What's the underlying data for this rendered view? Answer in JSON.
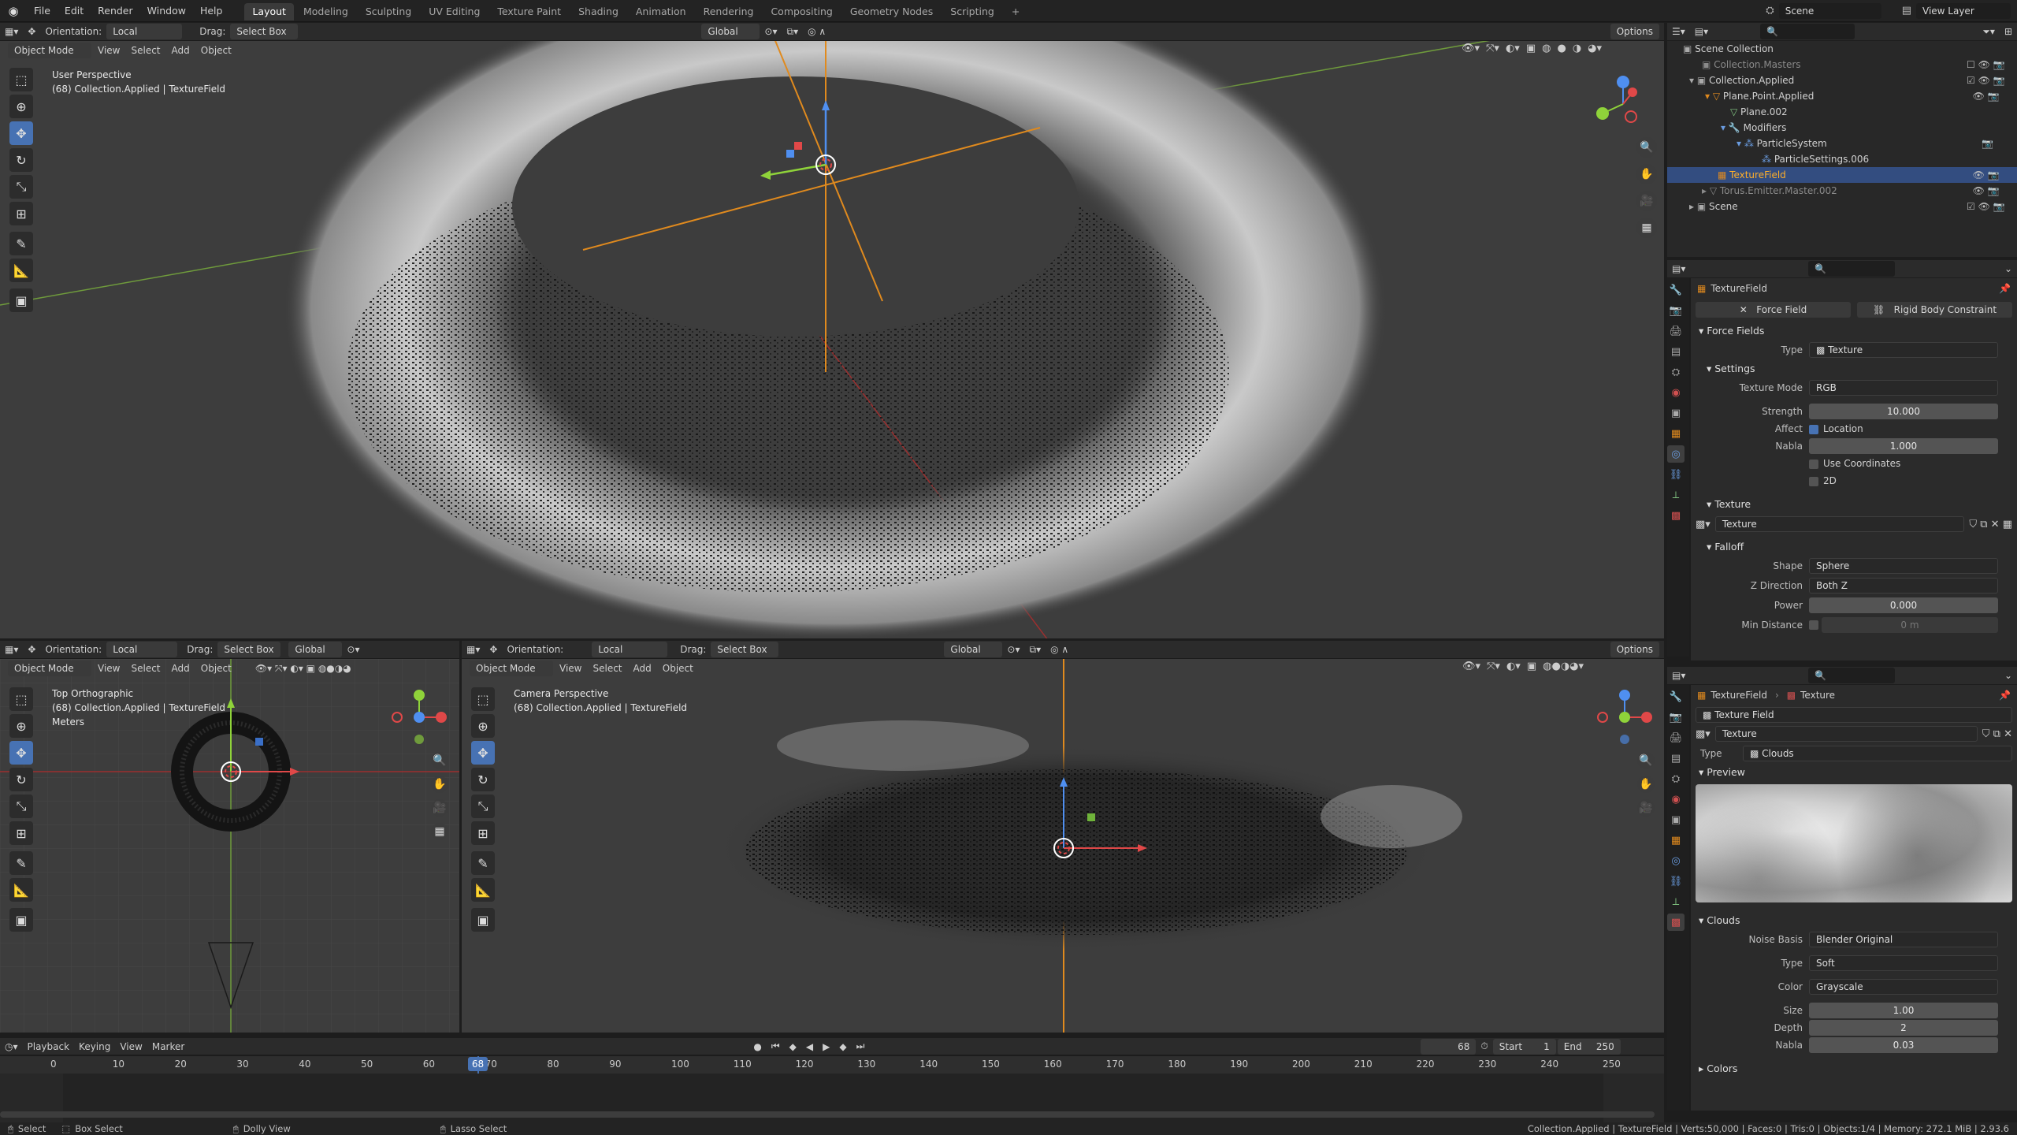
{
  "topbar": {
    "menus": [
      "File",
      "Edit",
      "Render",
      "Window",
      "Help"
    ],
    "workspaces": [
      "Layout",
      "Modeling",
      "Sculpting",
      "UV Editing",
      "Texture Paint",
      "Shading",
      "Animation",
      "Rendering",
      "Compositing",
      "Geometry Nodes",
      "Scripting"
    ],
    "active_workspace": "Layout",
    "scene": "Scene",
    "view_layer": "View Layer"
  },
  "main_viewport": {
    "orientation_label": "Orientation:",
    "orientation": "Local",
    "drag_label": "Drag:",
    "drag": "Select Box",
    "transform": "Global",
    "options": "Options",
    "menus": [
      "View",
      "Select",
      "Add",
      "Object"
    ],
    "mode": "Object Mode",
    "view_name": "User Perspective",
    "collection_info": "(68) Collection.Applied | TextureField"
  },
  "top_ortho": {
    "orientation_label": "Orientation:",
    "orientation": "Local",
    "drag_label": "Drag:",
    "drag": "Select Box",
    "transform": "Global",
    "mode": "Object Mode",
    "menus": [
      "View",
      "Select",
      "Add",
      "Object"
    ],
    "view_name": "Top Orthographic",
    "collection_info": "(68) Collection.Applied | TextureField",
    "units": "Meters"
  },
  "camera_view": {
    "orientation_label": "Orientation:",
    "orientation": "Local",
    "drag_label": "Drag:",
    "drag": "Select Box",
    "transform": "Global",
    "options": "Options",
    "mode": "Object Mode",
    "menus": [
      "View",
      "Select",
      "Add",
      "Object"
    ],
    "view_name": "Camera Perspective",
    "collection_info": "(68) Collection.Applied | TextureField"
  },
  "outliner": {
    "root": "Scene Collection",
    "items": [
      {
        "label": "Collection.Masters",
        "dim": true
      },
      {
        "label": "Collection.Applied",
        "dim": false
      },
      {
        "label": "Plane.Point.Applied",
        "dim": false
      },
      {
        "label": "Plane.002",
        "dim": false
      },
      {
        "label": "Modifiers",
        "dim": false
      },
      {
        "label": "ParticleSystem",
        "dim": false
      },
      {
        "label": "ParticleSettings.006",
        "dim": false
      },
      {
        "label": "TextureField",
        "dim": false
      },
      {
        "label": "Torus.Emitter.Master.002",
        "dim": true
      },
      {
        "label": "Scene",
        "dim": false
      }
    ]
  },
  "physics_props": {
    "object_name": "TextureField",
    "tab_force_field": "Force Field",
    "tab_rigid_body": "Rigid Body Constraint",
    "force_fields_header": "Force Fields",
    "type_label": "Type",
    "type_value": "Texture",
    "settings_header": "Settings",
    "texture_mode_label": "Texture Mode",
    "texture_mode_value": "RGB",
    "strength_label": "Strength",
    "strength_value": "10.000",
    "affect_label": "Affect",
    "affect_location": "Location",
    "nabla_label": "Nabla",
    "nabla_value": "1.000",
    "use_coordinates": "Use Coordinates",
    "two_d": "2D",
    "texture_header": "Texture",
    "texture_value": "Texture",
    "falloff_header": "Falloff",
    "shape_label": "Shape",
    "shape_value": "Sphere",
    "zdir_label": "Z Direction",
    "zdir_value": "Both Z",
    "power_label": "Power",
    "power_value": "0.000",
    "mindist_label": "Min Distance",
    "mindist_value": "0 m"
  },
  "texture_props": {
    "breadcrumb_object": "TextureField",
    "breadcrumb_texture": "Texture",
    "texture_field": "Texture Field",
    "texture_name": "Texture",
    "type_label": "Type",
    "type_value": "Clouds",
    "preview_header": "Preview",
    "clouds_header": "Clouds",
    "noise_basis_label": "Noise Basis",
    "noise_basis_value": "Blender Original",
    "ctype_label": "Type",
    "ctype_value": "Soft",
    "color_label": "Color",
    "color_value": "Grayscale",
    "size_label": "Size",
    "size_value": "1.00",
    "depth_label": "Depth",
    "depth_value": "2",
    "nabla_label": "Nabla",
    "nabla_value": "0.03",
    "colors_header": "Colors"
  },
  "timeline": {
    "menus": [
      "Playback",
      "Keying",
      "View",
      "Marker"
    ],
    "current_frame": "68",
    "start_label": "Start",
    "start": "1",
    "end_label": "End",
    "end": "250",
    "ticks": [
      0,
      10,
      20,
      30,
      40,
      50,
      60,
      70,
      80,
      90,
      100,
      110,
      120,
      130,
      140,
      150,
      160,
      170,
      180,
      190,
      200,
      210,
      220,
      230,
      240,
      250
    ]
  },
  "statusbar": {
    "select": "Select",
    "box_select": "Box Select",
    "dolly_view": "Dolly View",
    "lasso_select": "Lasso Select",
    "stats": "Collection.Applied | TextureField | Verts:50,000 | Faces:0 | Tris:0 | Objects:1/4 | Memory: 272.1 MiB | 2.93.6"
  }
}
